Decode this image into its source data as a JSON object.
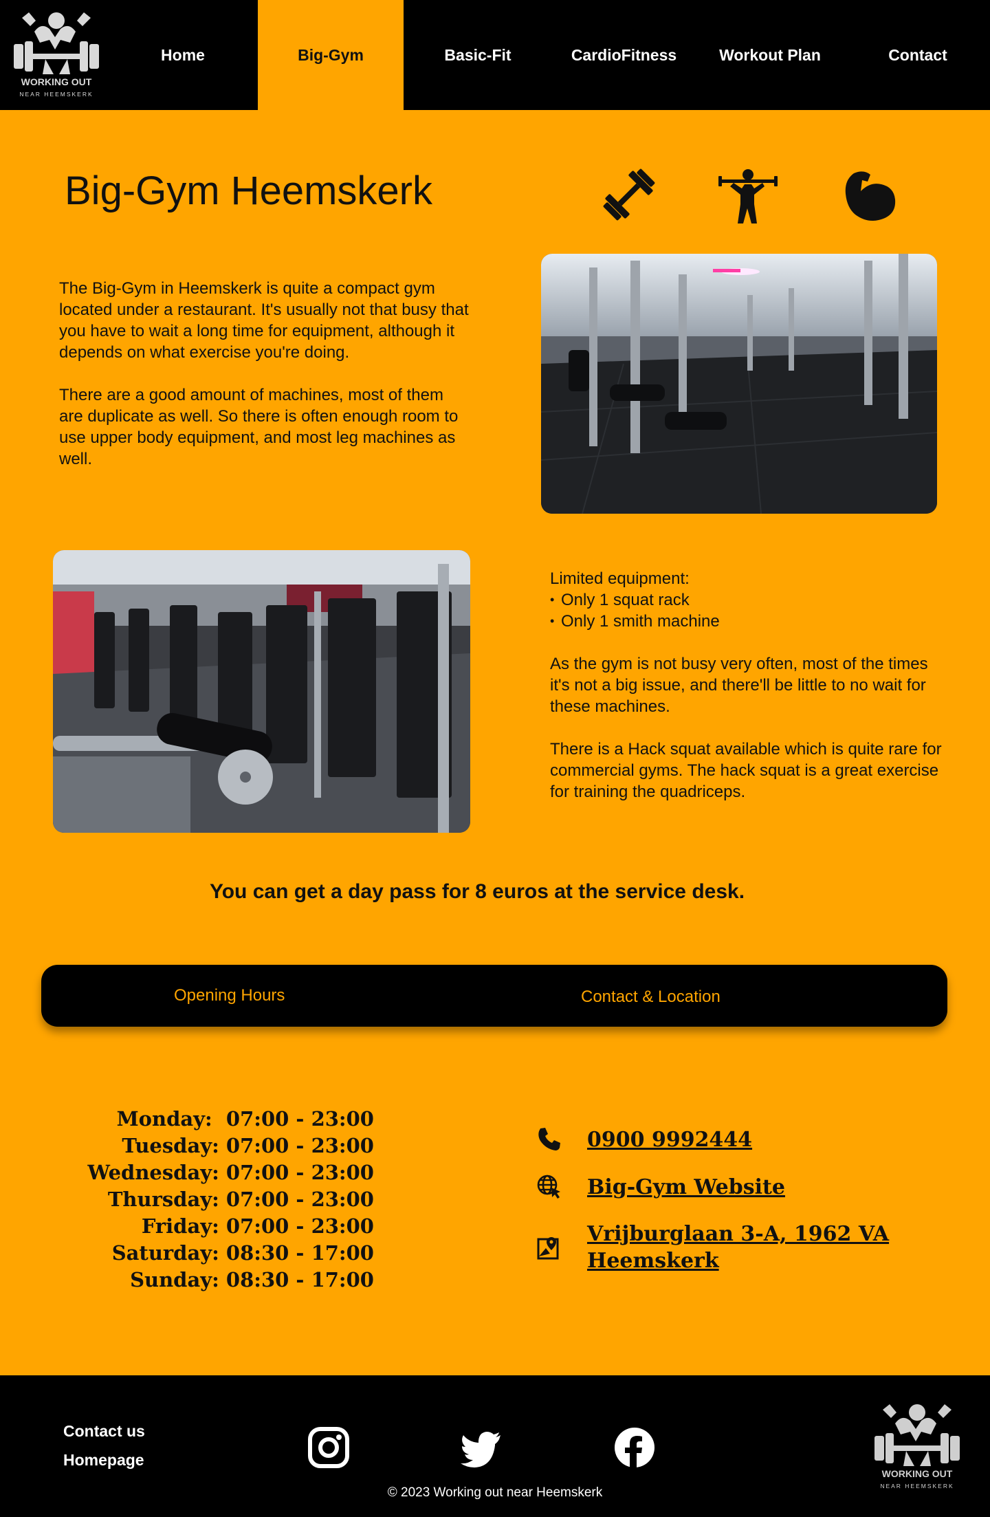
{
  "nav": {
    "logo_text": "WORKING OUT",
    "logo_subtext": "NEAR HEEMSKERK",
    "items": [
      {
        "label": "Home",
        "active": false
      },
      {
        "label": "Big-Gym",
        "active": true
      },
      {
        "label": "Basic-Fit",
        "active": false
      },
      {
        "label": "CardioFitness",
        "active": false
      },
      {
        "label": "Workout Plan",
        "active": false
      },
      {
        "label": "Contact",
        "active": false
      }
    ]
  },
  "hero": {
    "title": "Big-Gym Heemskerk",
    "icons": [
      "dumbbell-icon",
      "weightlifter-icon",
      "flexed-bicep-icon"
    ]
  },
  "intro": {
    "p1": "The Big-Gym in Heemskerk is quite a compact gym located under a restaurant. It's usually not that busy that you have to wait a long time for equipment, although it depends on what exercise you're doing.",
    "p2": "There are a good amount of machines, most of them are duplicate as well. So there is often enough room to use upper body equipment, and most leg machines as well."
  },
  "details": {
    "heading": "Limited equipment:",
    "items": [
      "Only 1 squat rack",
      "Only 1 smith machine"
    ],
    "p1": "As the gym is not busy very often, most of the times it's not a big issue, and there'll be little to no wait for these machines.",
    "p2": "There is a Hack squat available which is quite rare for commercial gyms. The hack squat is a great exercise for training the quadriceps."
  },
  "daypass": "You can get a day pass for 8 euros at the service desk.",
  "tabs": {
    "hours": "Opening Hours",
    "contact": "Contact & Location"
  },
  "hours": [
    {
      "day": "Monday:",
      "time": "07:00 - 23:00"
    },
    {
      "day": "Tuesday:",
      "time": "07:00 - 23:00"
    },
    {
      "day": "Wednesday:",
      "time": "07:00 - 23:00"
    },
    {
      "day": "Thursday:",
      "time": "07:00 - 23:00"
    },
    {
      "day": "Friday:",
      "time": "07:00 - 23:00"
    },
    {
      "day": "Saturday:",
      "time": "08:30 - 17:00"
    },
    {
      "day": "Sunday:",
      "time": "08:30 - 17:00"
    }
  ],
  "contact": {
    "phone": "0900 9992444",
    "website": "Big-Gym Website",
    "address_line1": "Vrijburglaan 3-A, 1962 VA",
    "address_line2": "Heemskerk"
  },
  "footer": {
    "contact_us": "Contact us",
    "homepage": "Homepage",
    "copyright": "© 2023 Working out near Heemskerk",
    "social": [
      "instagram-icon",
      "twitter-icon",
      "facebook-icon"
    ]
  },
  "colors": {
    "accent": "#FFA500",
    "dark": "#000000",
    "text": "#111111"
  }
}
